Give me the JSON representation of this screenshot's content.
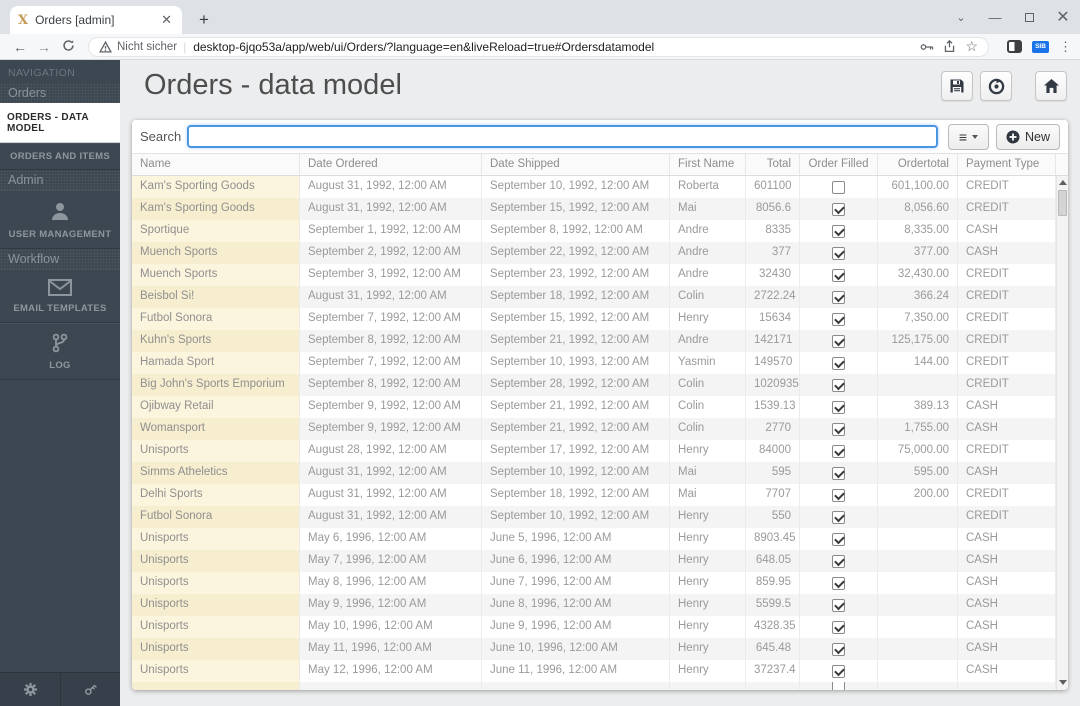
{
  "colors": {
    "accent": "#4b96e0",
    "sidebar": "#3d4751",
    "name_column": "#fcf5dd",
    "name_column_alt": "#f7eecf",
    "extension_badge": "#1a73e8"
  },
  "browser": {
    "tab_title": "Orders [admin]",
    "security_text": "Nicht sicher",
    "url": "desktop-6jqo53a/app/web/ui/Orders/?language=en&liveReload=true#Ordersdatamodel",
    "extension_badge": "SIB"
  },
  "sidebar": {
    "nav_label": "NAVIGATION",
    "groups": [
      {
        "header": "Orders",
        "items": [
          {
            "label": "ORDERS - DATA MODEL",
            "active": true
          },
          {
            "label": "ORDERS AND ITEMS"
          }
        ]
      },
      {
        "header": "Admin",
        "items": [
          {
            "label": "USER MANAGEMENT",
            "icon": "user"
          }
        ]
      },
      {
        "header": "Workflow",
        "items": [
          {
            "label": "EMAIL TEMPLATES",
            "icon": "envelope"
          },
          {
            "label": "LOG",
            "icon": "branch"
          }
        ]
      }
    ]
  },
  "header": {
    "title": "Orders - data model"
  },
  "toolbar": {
    "search_label": "Search",
    "search_value": "",
    "new_label": "New"
  },
  "table": {
    "columns": [
      {
        "label": "Name"
      },
      {
        "label": "Date Ordered"
      },
      {
        "label": "Date Shipped"
      },
      {
        "label": "First Name"
      },
      {
        "label": "Total"
      },
      {
        "label": "Order Filled"
      },
      {
        "label": "Ordertotal"
      },
      {
        "label": "Payment Type"
      }
    ],
    "rows": [
      {
        "name": "Kam's Sporting Goods",
        "ordered": "August 31, 1992, 12:00 AM",
        "shipped": "September 10, 1992, 12:00 AM",
        "first_name": "Roberta",
        "total": "601100",
        "filled": false,
        "ordertotal": "601,100.00",
        "payment": "CREDIT"
      },
      {
        "name": "Kam's Sporting Goods",
        "ordered": "August 31, 1992, 12:00 AM",
        "shipped": "September 15, 1992, 12:00 AM",
        "first_name": "Mai",
        "total": "8056.6",
        "filled": true,
        "ordertotal": "8,056.60",
        "payment": "CREDIT"
      },
      {
        "name": "Sportique",
        "ordered": "September 1, 1992, 12:00 AM",
        "shipped": "September 8, 1992, 12:00 AM",
        "first_name": "Andre",
        "total": "8335",
        "filled": true,
        "ordertotal": "8,335.00",
        "payment": "CASH"
      },
      {
        "name": "Muench Sports",
        "ordered": "September 2, 1992, 12:00 AM",
        "shipped": "September 22, 1992, 12:00 AM",
        "first_name": "Andre",
        "total": "377",
        "filled": true,
        "ordertotal": "377.00",
        "payment": "CASH"
      },
      {
        "name": "Muench Sports",
        "ordered": "September 3, 1992, 12:00 AM",
        "shipped": "September 23, 1992, 12:00 AM",
        "first_name": "Andre",
        "total": "32430",
        "filled": true,
        "ordertotal": "32,430.00",
        "payment": "CREDIT"
      },
      {
        "name": "Beisbol Si!",
        "ordered": "August 31, 1992, 12:00 AM",
        "shipped": "September 18, 1992, 12:00 AM",
        "first_name": "Colin",
        "total": "2722.24",
        "filled": true,
        "ordertotal": "366.24",
        "payment": "CREDIT"
      },
      {
        "name": "Futbol Sonora",
        "ordered": "September 7, 1992, 12:00 AM",
        "shipped": "September 15, 1992, 12:00 AM",
        "first_name": "Henry",
        "total": "15634",
        "filled": true,
        "ordertotal": "7,350.00",
        "payment": "CREDIT"
      },
      {
        "name": "Kuhn's Sports",
        "ordered": "September 8, 1992, 12:00 AM",
        "shipped": "September 21, 1992, 12:00 AM",
        "first_name": "Andre",
        "total": "142171",
        "filled": true,
        "ordertotal": "125,175.00",
        "payment": "CREDIT"
      },
      {
        "name": "Hamada Sport",
        "ordered": "September 7, 1992, 12:00 AM",
        "shipped": "September 10, 1993, 12:00 AM",
        "first_name": "Yasmin",
        "total": "149570",
        "filled": true,
        "ordertotal": "144.00",
        "payment": "CREDIT"
      },
      {
        "name": "Big John's Sports Emporium",
        "ordered": "September 8, 1992, 12:00 AM",
        "shipped": "September 28, 1992, 12:00 AM",
        "first_name": "Colin",
        "total": "1020935",
        "filled": true,
        "ordertotal": "",
        "payment": "CREDIT"
      },
      {
        "name": "Ojibway Retail",
        "ordered": "September 9, 1992, 12:00 AM",
        "shipped": "September 21, 1992, 12:00 AM",
        "first_name": "Colin",
        "total": "1539.13",
        "filled": true,
        "ordertotal": "389.13",
        "payment": "CASH"
      },
      {
        "name": "Womansport",
        "ordered": "September 9, 1992, 12:00 AM",
        "shipped": "September 21, 1992, 12:00 AM",
        "first_name": "Colin",
        "total": "2770",
        "filled": true,
        "ordertotal": "1,755.00",
        "payment": "CASH"
      },
      {
        "name": "Unisports",
        "ordered": "August 28, 1992, 12:00 AM",
        "shipped": "September 17, 1992, 12:00 AM",
        "first_name": "Henry",
        "total": "84000",
        "filled": true,
        "ordertotal": "75,000.00",
        "payment": "CREDIT"
      },
      {
        "name": "Simms Atheletics",
        "ordered": "August 31, 1992, 12:00 AM",
        "shipped": "September 10, 1992, 12:00 AM",
        "first_name": "Mai",
        "total": "595",
        "filled": true,
        "ordertotal": "595.00",
        "payment": "CASH"
      },
      {
        "name": "Delhi Sports",
        "ordered": "August 31, 1992, 12:00 AM",
        "shipped": "September 18, 1992, 12:00 AM",
        "first_name": "Mai",
        "total": "7707",
        "filled": true,
        "ordertotal": "200.00",
        "payment": "CREDIT"
      },
      {
        "name": "Futbol Sonora",
        "ordered": "August 31, 1992, 12:00 AM",
        "shipped": "September 10, 1992, 12:00 AM",
        "first_name": "Henry",
        "total": "550",
        "filled": true,
        "ordertotal": "",
        "payment": "CREDIT"
      },
      {
        "name": "Unisports",
        "ordered": "May 6, 1996, 12:00 AM",
        "shipped": "June 5, 1996, 12:00 AM",
        "first_name": "Henry",
        "total": "8903.45",
        "filled": true,
        "ordertotal": "",
        "payment": "CASH"
      },
      {
        "name": "Unisports",
        "ordered": "May 7, 1996, 12:00 AM",
        "shipped": "June 6, 1996, 12:00 AM",
        "first_name": "Henry",
        "total": "648.05",
        "filled": true,
        "ordertotal": "",
        "payment": "CASH"
      },
      {
        "name": "Unisports",
        "ordered": "May 8, 1996, 12:00 AM",
        "shipped": "June 7, 1996, 12:00 AM",
        "first_name": "Henry",
        "total": "859.95",
        "filled": true,
        "ordertotal": "",
        "payment": "CASH"
      },
      {
        "name": "Unisports",
        "ordered": "May 9, 1996, 12:00 AM",
        "shipped": "June 8, 1996, 12:00 AM",
        "first_name": "Henry",
        "total": "5599.5",
        "filled": true,
        "ordertotal": "",
        "payment": "CASH"
      },
      {
        "name": "Unisports",
        "ordered": "May 10, 1996, 12:00 AM",
        "shipped": "June 9, 1996, 12:00 AM",
        "first_name": "Henry",
        "total": "4328.35",
        "filled": true,
        "ordertotal": "",
        "payment": "CASH"
      },
      {
        "name": "Unisports",
        "ordered": "May 11, 1996, 12:00 AM",
        "shipped": "June 10, 1996, 12:00 AM",
        "first_name": "Henry",
        "total": "645.48",
        "filled": true,
        "ordertotal": "",
        "payment": "CASH"
      },
      {
        "name": "Unisports",
        "ordered": "May 12, 1996, 12:00 AM",
        "shipped": "June 11, 1996, 12:00 AM",
        "first_name": "Henry",
        "total": "37237.4",
        "filled": true,
        "ordertotal": "",
        "payment": "CASH"
      }
    ]
  }
}
